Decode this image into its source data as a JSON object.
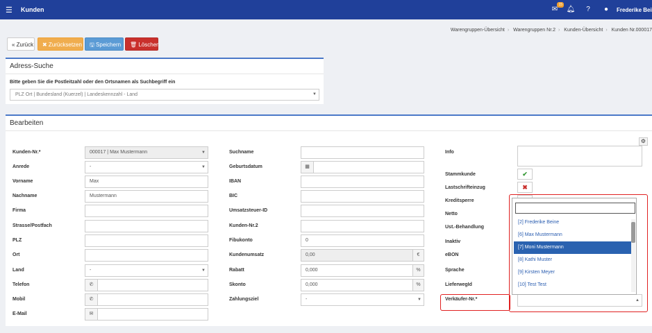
{
  "topbar": {
    "menu_icon": "hamburger-icon",
    "title": "Kunden",
    "badge": "15",
    "user": "Frederike Beine"
  },
  "breadcrumbs": [
    "Warengruppen-Übersicht",
    "Warengruppen Nr.2",
    "Kunden-Übersicht",
    "Kunden Nr.000017"
  ],
  "toolbar": {
    "back": "« Zurück",
    "reset": "✖ Zurücksetzen",
    "save": "🖫 Speichern",
    "delete": "🗑 Löschen"
  },
  "address": {
    "title": "Adress-Suche",
    "hint": "Bitte geben Sie die Postleitzahl oder den Ortsnamen als Suchbegriff ein",
    "placeholder": "PLZ Ort | Bundesland (Kuerzel) | Landeskennzahl - Land"
  },
  "edit": {
    "title": "Bearbeiten",
    "col1": [
      {
        "label": "Kunden-Nr.*",
        "value": "000017 | Max Mustermann"
      },
      {
        "label": "Anrede",
        "value": "-"
      },
      {
        "label": "Vorname",
        "value": "Max"
      },
      {
        "label": "Nachname",
        "value": "Mustermann"
      },
      {
        "label": "Firma",
        "value": ""
      },
      {
        "label": "Strasse/Postfach",
        "value": ""
      },
      {
        "label": "PLZ",
        "value": ""
      },
      {
        "label": "Ort",
        "value": ""
      },
      {
        "label": "Land",
        "value": "-"
      },
      {
        "label": "Telefon",
        "value": ""
      },
      {
        "label": "Mobil",
        "value": ""
      },
      {
        "label": "E-Mail",
        "value": ""
      }
    ],
    "col2": [
      {
        "label": "Suchname",
        "value": ""
      },
      {
        "label": "Geburtsdatum",
        "value": ""
      },
      {
        "label": "IBAN",
        "value": ""
      },
      {
        "label": "BIC",
        "value": ""
      },
      {
        "label": "Umsatzsteuer-ID",
        "value": ""
      },
      {
        "label": "Kunden-Nr.2",
        "value": ""
      },
      {
        "label": "Fibukonto",
        "value": "0"
      },
      {
        "label": "Kundenumsatz",
        "value": "0,00",
        "unit": "€"
      },
      {
        "label": "Rabatt",
        "value": "0,000",
        "unit": "%"
      },
      {
        "label": "Skonto",
        "value": "0,000",
        "unit": "%"
      },
      {
        "label": "Zahlungsziel",
        "value": "-"
      }
    ],
    "col3": [
      {
        "label": "Info"
      },
      {
        "label": "Stammkunde"
      },
      {
        "label": "Lastschrifteinzug"
      },
      {
        "label": "Kreditsperre"
      },
      {
        "label": "Netto"
      },
      {
        "label": "Ust.-Behandlung"
      },
      {
        "label": "Inaktiv"
      },
      {
        "label": "eBON"
      },
      {
        "label": "Sprache"
      },
      {
        "label": "LieferwegId"
      },
      {
        "label": "Verkäufer-Nr.*"
      }
    ]
  },
  "dropdown": {
    "options": [
      "[2] Frederike Beine",
      "[6] Max Mustermann",
      "[7] Moni Mustermann",
      "[8] Kathi Muster",
      "[9] Kirsten Meyer",
      "[10] Test Test"
    ],
    "selected_index": 2
  }
}
